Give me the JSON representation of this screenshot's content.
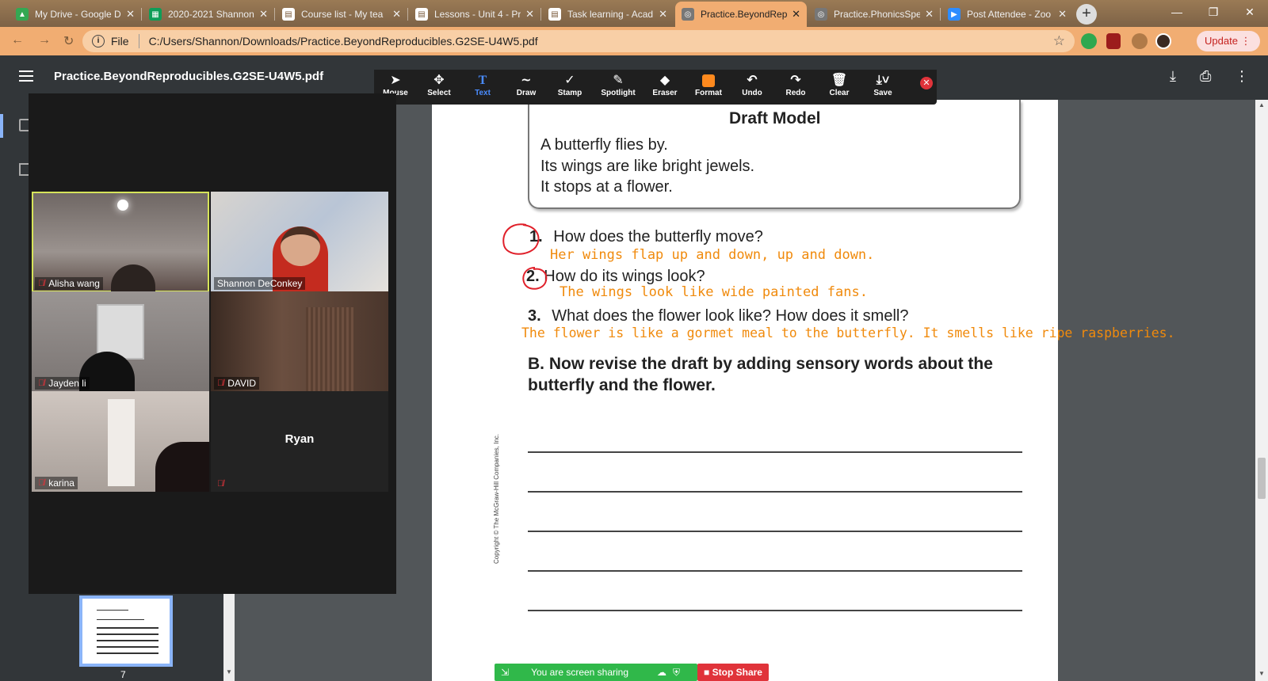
{
  "browser": {
    "tabs": [
      {
        "title": "My Drive - Google Dr",
        "icon": "google-drive-icon",
        "color": "#34a853"
      },
      {
        "title": "2020-2021 Shannon",
        "icon": "google-sheets-icon",
        "color": "#0f9d58"
      },
      {
        "title": "Course list - My tea",
        "icon": "document-icon",
        "color": "#ffffff"
      },
      {
        "title": "Lessons - Unit 4 - Pr",
        "icon": "document-icon",
        "color": "#ffffff"
      },
      {
        "title": "Task learning - Acad",
        "icon": "document-icon",
        "color": "#ffffff"
      },
      {
        "title": "Practice.BeyondRep",
        "icon": "globe-icon",
        "color": "#777777"
      },
      {
        "title": "Practice.PhonicsSpe",
        "icon": "globe-icon",
        "color": "#777777"
      },
      {
        "title": "Post Attendee - Zoo",
        "icon": "zoom-icon",
        "color": "#2d8cff"
      }
    ],
    "active_tab_index": 5,
    "address": {
      "scheme_label": "File",
      "path": "C:/Users/Shannon/Downloads/Practice.BeyondReproducibles.G2SE-U4W5.pdf"
    },
    "update_label": "Update"
  },
  "pdf": {
    "filename": "Practice.BeyondReproducibles.G2SE-U4W5.pdf",
    "sidebar_page_number": "7",
    "content": {
      "draft_title": "Draft Model",
      "draft_lines": [
        "A butterfly flies by.",
        "Its wings are like bright jewels.",
        "It stops at a flower."
      ],
      "questions": [
        {
          "num": "1.",
          "text": "How does the butterfly move?",
          "answer": "Her wings flap up and down, up and down."
        },
        {
          "num": "2.",
          "text": "How do its wings look?",
          "answer": "The wings look like wide painted fans."
        },
        {
          "num": "3.",
          "text": "What does the flower look like? How does it smell?",
          "answer": "The flower is like a gormet meal to the butterfly. It smells like ripe raspberries."
        }
      ],
      "section_b": "B. Now revise the draft by adding sensory words about the butterfly and the flower.",
      "copyright": "Copyright © The McGraw-Hill Companies, Inc."
    }
  },
  "zoom": {
    "annotation_tools": [
      {
        "label": "Mouse",
        "icon": "cursor-icon"
      },
      {
        "label": "Select",
        "icon": "move-icon"
      },
      {
        "label": "Text",
        "icon": "text-icon"
      },
      {
        "label": "Draw",
        "icon": "draw-icon"
      },
      {
        "label": "Stamp",
        "icon": "check-icon"
      },
      {
        "label": "Spotlight",
        "icon": "spotlight-icon"
      },
      {
        "label": "Eraser",
        "icon": "eraser-icon"
      },
      {
        "label": "Format",
        "icon": "format-icon"
      },
      {
        "label": "Undo",
        "icon": "undo-icon"
      },
      {
        "label": "Redo",
        "icon": "redo-icon"
      },
      {
        "label": "Clear",
        "icon": "trash-icon"
      },
      {
        "label": "Save",
        "icon": "save-icon"
      }
    ],
    "participants": [
      {
        "name": "Alisha wang",
        "muted": true,
        "speaking": true
      },
      {
        "name": "Shannon DeConkey",
        "muted": false,
        "speaking": false
      },
      {
        "name": "Jayden li",
        "muted": true,
        "speaking": false
      },
      {
        "name": "DAVID",
        "muted": true,
        "speaking": false
      },
      {
        "name": "karina",
        "muted": true,
        "speaking": false
      },
      {
        "name": "Ryan",
        "muted": true,
        "speaking": false
      }
    ],
    "share_status": "You are screen sharing",
    "stop_share_label": "Stop Share",
    "colors": {
      "answer_ink": "#f08a0c",
      "annotation_circle": "#e0202a",
      "share_green": "#30b84a",
      "stop_red": "#e0333a"
    }
  }
}
